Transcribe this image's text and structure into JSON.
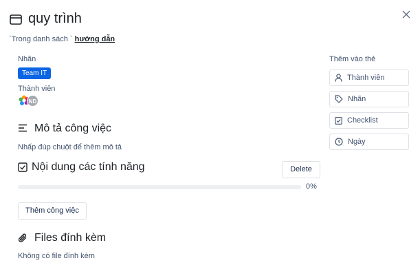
{
  "card": {
    "title": "quy trình",
    "list_prefix": "`Trong danh sách ` ",
    "list_name": "hướng dẫn"
  },
  "labels": {
    "heading": "Nhãn",
    "items": [
      {
        "text": "Team IT",
        "color": "#0c66e4"
      }
    ]
  },
  "members": {
    "heading": "Thành viên",
    "avatars": [
      {
        "icon": "flower-logo-avatar"
      },
      {
        "initials": "ND",
        "color": "#a6a9ad"
      }
    ]
  },
  "description": {
    "heading": "Mô tả công việc",
    "placeholder": "Nhấp đúp chuột để thêm mô tả"
  },
  "checklist": {
    "heading": "Nội dung các tính năng",
    "delete_label": "Delete",
    "progress_percent": 0,
    "progress_label": "0%",
    "add_item_label": "Thêm công việc"
  },
  "attachments": {
    "heading": "Files đính kèm",
    "empty_text": "Không có file đính kèm"
  },
  "sidebar": {
    "heading": "Thêm vào thẻ",
    "buttons": [
      {
        "label": "Thành viên",
        "icon": "person-icon"
      },
      {
        "label": "Nhãn",
        "icon": "tag-icon"
      },
      {
        "label": "Checklist",
        "icon": "checkbox-icon"
      },
      {
        "label": "Ngày",
        "icon": "clock-icon"
      }
    ]
  }
}
